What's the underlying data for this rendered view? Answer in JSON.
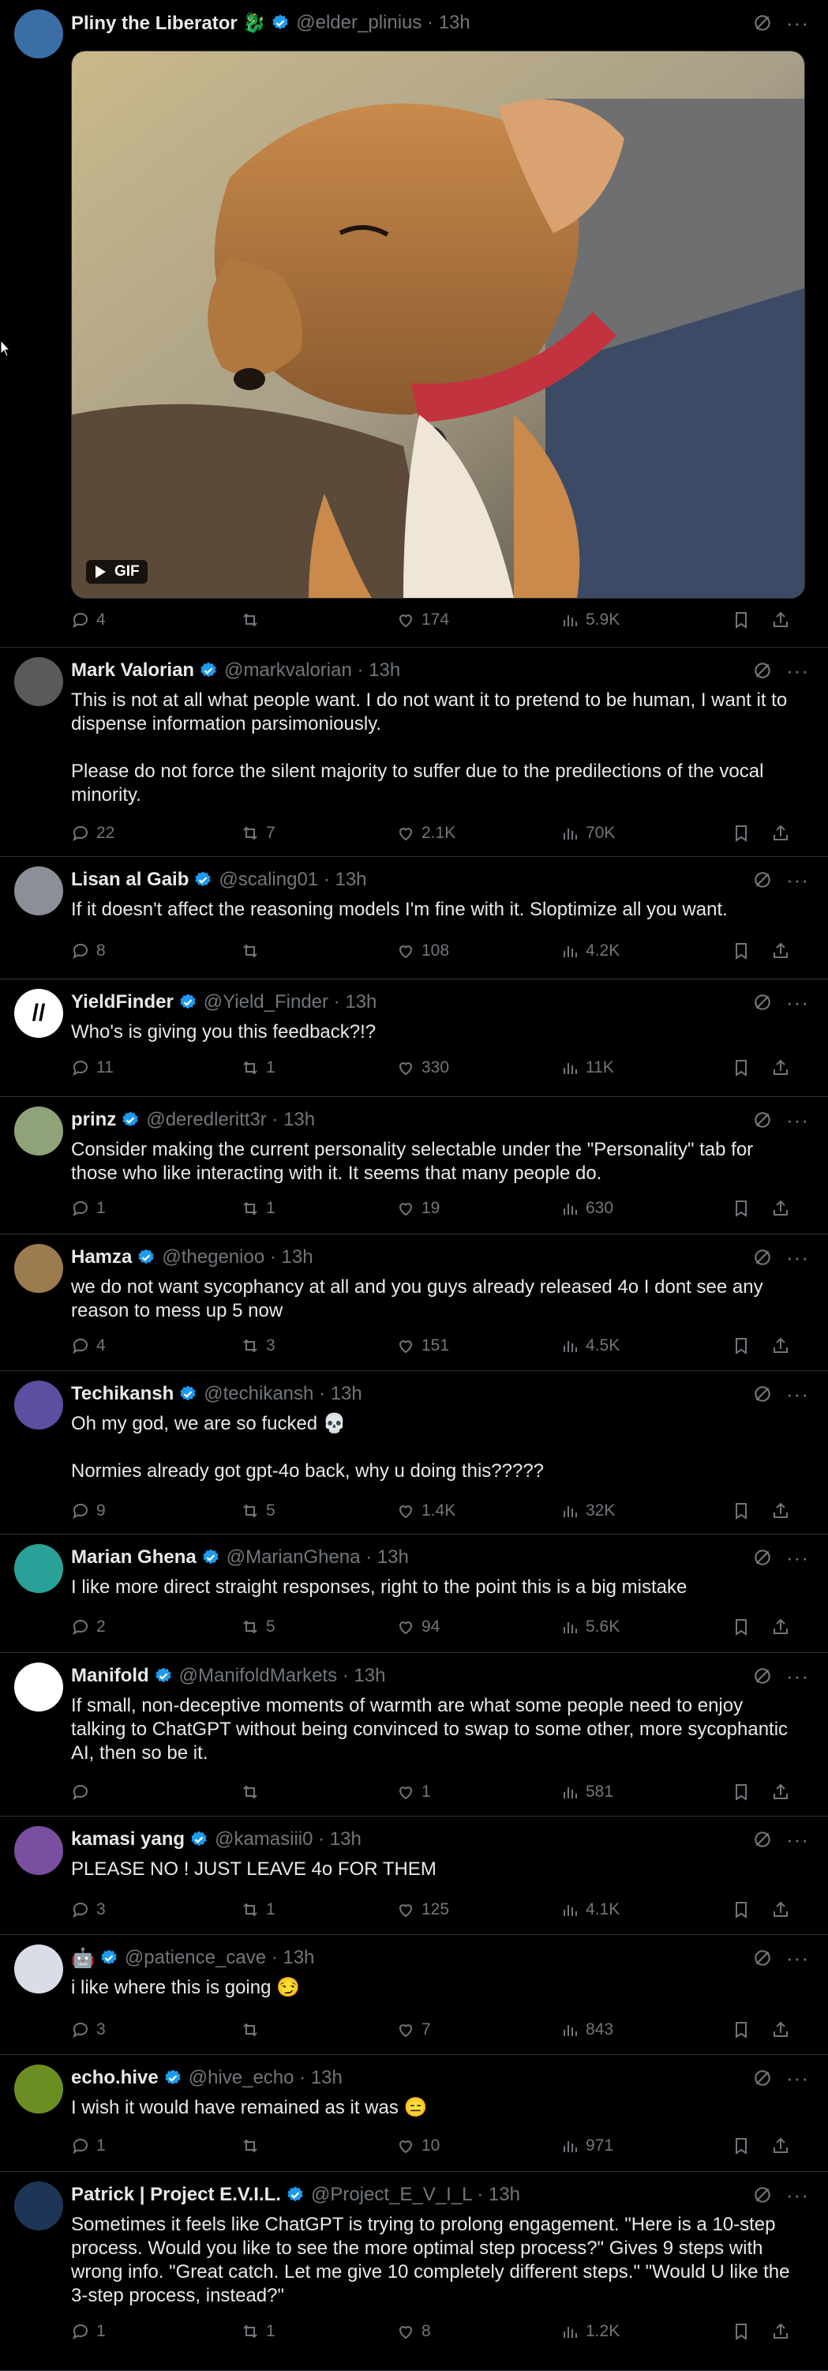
{
  "gif_label": "GIF",
  "tweets": [
    {
      "name": "Pliny the Liberator 🐉",
      "handle": "@elder_plinius · 13h",
      "body": "",
      "replies": "4",
      "reposts": "",
      "likes": "174",
      "views": "5.9K",
      "avatar_color": "#3a6ea5"
    },
    {
      "name": "Mark Valorian",
      "handle": "@markvalorian · 13h",
      "body": "This is not at all what people want. I do not want it to pretend to be human, I want it to dispense information parsimoniously.\n\nPlease do not force the silent majority to suffer due to the predilections of the vocal minority.",
      "replies": "22",
      "reposts": "7",
      "likes": "2.1K",
      "views": "70K",
      "avatar_color": "#5a5a5a"
    },
    {
      "name": "Lisan al Gaib",
      "handle": "@scaling01 · 13h",
      "body": "If it doesn't affect the reasoning models I'm fine with it. Sloptimize all you want.",
      "replies": "8",
      "reposts": "",
      "likes": "108",
      "views": "4.2K",
      "avatar_color": "#8a8f98"
    },
    {
      "name": "YieldFinder",
      "handle": "@Yield_Finder · 13h",
      "body": "Who's is giving you this feedback?!?",
      "replies": "11",
      "reposts": "1",
      "likes": "330",
      "views": "11K",
      "avatar_color": "#ffffff",
      "avatar_text": "//"
    },
    {
      "name": "prinz",
      "handle": "@deredleritt3r · 13h",
      "body": "Consider making the current personality selectable under the \"Personality\" tab for those who like interacting with it. It seems that many people do.",
      "replies": "1",
      "reposts": "1",
      "likes": "19",
      "views": "630",
      "avatar_color": "#8fa27a"
    },
    {
      "name": "Hamza",
      "handle": "@thegenioo · 13h",
      "body": "we do not want sycophancy at all and you guys already released 4o I dont see any reason to mess up 5 now",
      "replies": "4",
      "reposts": "3",
      "likes": "151",
      "views": "4.5K",
      "avatar_color": "#9c7b4e"
    },
    {
      "name": "Techikansh",
      "handle": "@techikansh · 13h",
      "body": "Oh my god, we are so fucked 💀\n\nNormies already got gpt-4o back, why u doing this?????",
      "replies": "9",
      "reposts": "5",
      "likes": "1.4K",
      "views": "32K",
      "avatar_color": "#5a4fa0"
    },
    {
      "name": "Marian Ghena",
      "handle": "@MarianGhena · 13h",
      "body": "I like more direct straight responses, right to the point this is a big mistake",
      "replies": "2",
      "reposts": "5",
      "likes": "94",
      "views": "5.6K",
      "avatar_color": "#2aa198"
    },
    {
      "name": "Manifold",
      "handle": "@ManifoldMarkets · 13h",
      "body": "If small, non-deceptive moments of warmth are what some people need to enjoy talking to ChatGPT without being convinced to swap to some other, more sycophantic AI, then so be it.",
      "replies": "",
      "reposts": "",
      "likes": "1",
      "views": "581",
      "avatar_color": "#ffffff"
    },
    {
      "name": "kamasi yang",
      "handle": "@kamasiii0 · 13h",
      "body": "PLEASE NO ! JUST LEAVE 4o FOR THEM",
      "replies": "3",
      "reposts": "1",
      "likes": "125",
      "views": "4.1K",
      "avatar_color": "#7a4fa0"
    },
    {
      "name": "🤖",
      "handle": "@patience_cave · 13h",
      "body": "i like where this is going 😏",
      "replies": "3",
      "reposts": "",
      "likes": "7",
      "views": "843",
      "avatar_color": "#d8dde6"
    },
    {
      "name": "echo.hive",
      "handle": "@hive_echo · 13h",
      "body": "I wish it would have remained as it was 😑",
      "replies": "1",
      "reposts": "",
      "likes": "10",
      "views": "971",
      "avatar_color": "#6b8e23"
    },
    {
      "name": "Patrick | Project E.V.I.L.",
      "handle": "@Project_E_V_I_L · 13h",
      "body": "Sometimes it feels like ChatGPT is trying to prolong engagement. \"Here is a 10-step process. Would you like to see the more optimal step process?\" Gives 9 steps with wrong info. \"Great catch. Let me give 10 completely different steps.\" \"Would U like the 3-step process, instead?\"",
      "replies": "1",
      "reposts": "1",
      "likes": "8",
      "views": "1.2K",
      "avatar_color": "#1d3557"
    }
  ]
}
